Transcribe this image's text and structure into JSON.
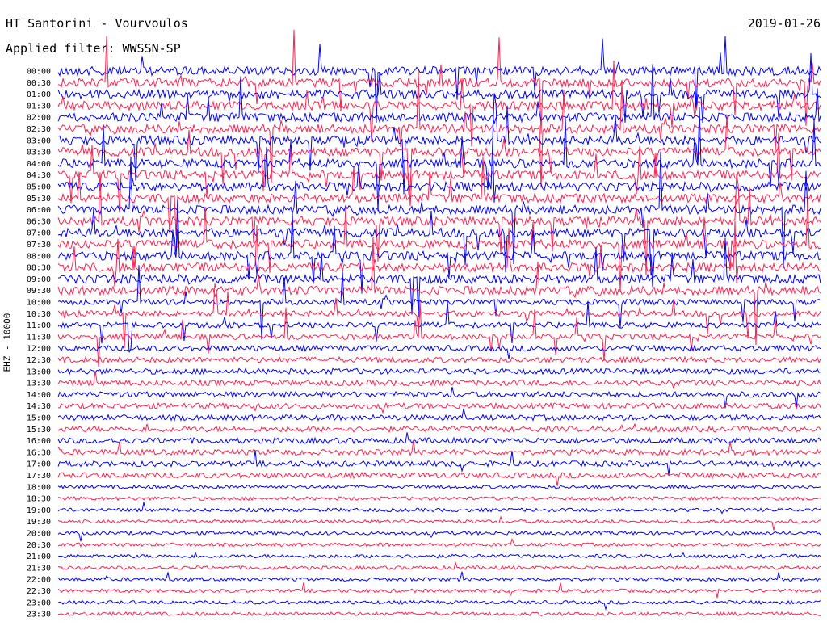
{
  "header": {
    "title": "HT Santorini - Vourvoulos",
    "filter": "Applied filter: WWSSN-SP",
    "date": "2019-01-26"
  },
  "colors": {
    "trace_a": "#0000ff",
    "trace_b": "#ff1f4f",
    "background": "#ffffff"
  },
  "chart_data": {
    "type": "line",
    "title": "HT Santorini - Vourvoulos",
    "ylabel": "EHZ - 10000",
    "row_labels": [
      "00:00",
      "00:30",
      "01:00",
      "01:30",
      "02:00",
      "02:30",
      "03:00",
      "03:30",
      "04:00",
      "04:30",
      "05:00",
      "05:30",
      "06:00",
      "06:30",
      "07:00",
      "07:30",
      "08:00",
      "08:30",
      "09:00",
      "09:30",
      "10:00",
      "10:30",
      "11:00",
      "11:30",
      "12:00",
      "12:30",
      "13:00",
      "13:30",
      "14:00",
      "14:30",
      "15:00",
      "15:30",
      "16:00",
      "16:30",
      "17:00",
      "17:30",
      "18:00",
      "18:30",
      "19:00",
      "19:30",
      "20:00",
      "20:30",
      "21:00",
      "21:30",
      "22:00",
      "22:30",
      "23:00",
      "23:30"
    ],
    "series_colors": [
      "#0000ff",
      "#ff1f4f"
    ]
  }
}
